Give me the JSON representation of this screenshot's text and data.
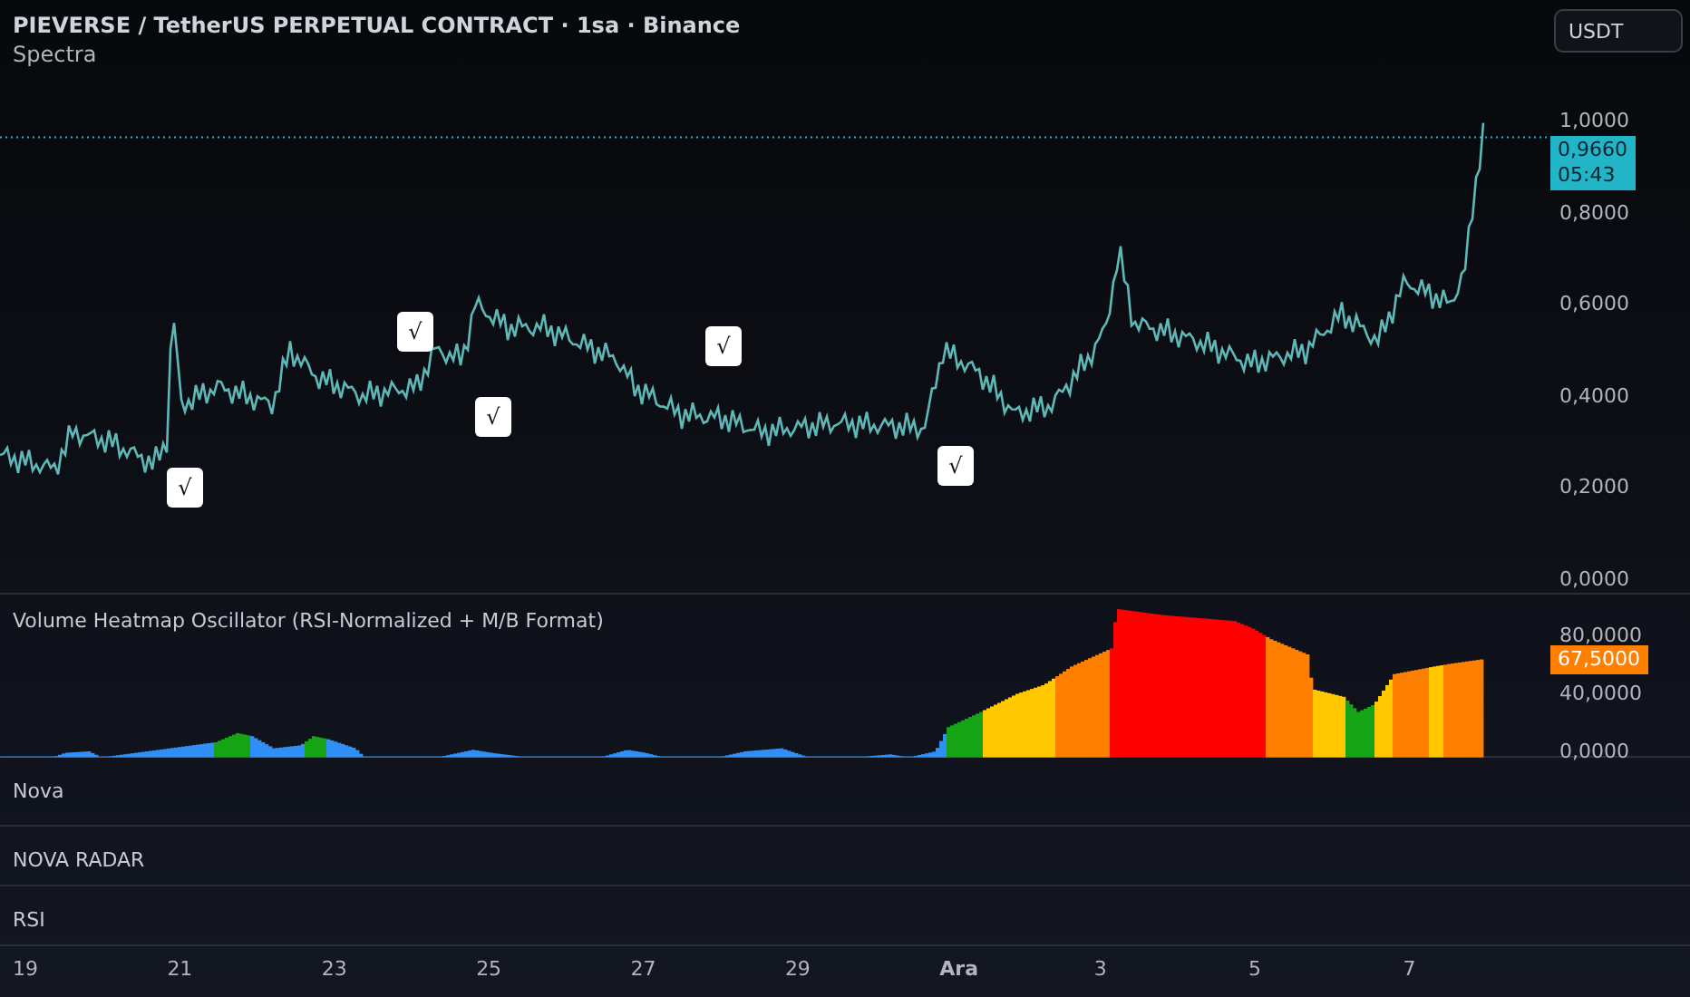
{
  "header": {
    "symbol_title": "PIEVERSE / TetherUS PERPETUAL CONTRACT · 1sa · Binance",
    "indicator": "Spectra"
  },
  "currency_button": "USDT",
  "price_pane": {
    "price_axis": [
      "1,0000",
      "0,8000",
      "0,6000",
      "0,4000",
      "0,2000",
      "0,0000"
    ],
    "last_price": "0,9660",
    "countdown": "05:43",
    "signals": [
      {
        "label": "√"
      },
      {
        "label": "√"
      },
      {
        "label": "√"
      },
      {
        "label": "√"
      },
      {
        "label": "√"
      }
    ]
  },
  "oscillator": {
    "title": "Volume Heatmap Oscillator (RSI-Normalized + M/B Format)",
    "axis": [
      "80,0000",
      "40,0000",
      "0,0000"
    ],
    "current_value": "67,5000"
  },
  "panes": [
    {
      "title": "Nova"
    },
    {
      "title": "NOVA RADAR"
    },
    {
      "title": "RSI"
    }
  ],
  "time_axis": [
    {
      "label": "19",
      "bold": false
    },
    {
      "label": "21",
      "bold": false
    },
    {
      "label": "23",
      "bold": false
    },
    {
      "label": "25",
      "bold": false
    },
    {
      "label": "27",
      "bold": false
    },
    {
      "label": "29",
      "bold": false
    },
    {
      "label": "Ara",
      "bold": true
    },
    {
      "label": "3",
      "bold": false
    },
    {
      "label": "5",
      "bold": false
    },
    {
      "label": "7",
      "bold": false
    }
  ]
}
